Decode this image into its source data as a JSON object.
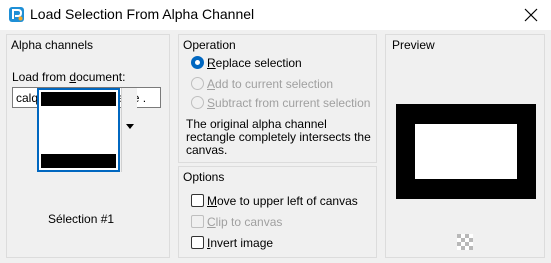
{
  "window": {
    "title": "Load Selection From Alpha Channel",
    "close_glyph": "×"
  },
  "alpha_channels": {
    "title": "Alpha channels",
    "load_label_prefix": "Load from ",
    "load_label_underlined": "d",
    "load_label_suffix": "ocument:",
    "document_value": "calque_alpha_adelaide .",
    "selection_name": "Sélection #1"
  },
  "operation": {
    "title": "Operation",
    "options": [
      {
        "prefix": "",
        "underlined": "R",
        "suffix": "eplace selection",
        "checked": true,
        "enabled": true
      },
      {
        "prefix": "",
        "underlined": "A",
        "suffix": "dd to current selection",
        "checked": false,
        "enabled": false
      },
      {
        "prefix": "",
        "underlined": "S",
        "suffix": "ubtract from current selection",
        "checked": false,
        "enabled": false
      }
    ],
    "description": "The original alpha channel rectangle completely intersects the canvas."
  },
  "options": {
    "title": "Options",
    "items": [
      {
        "prefix": "",
        "underlined": "M",
        "suffix": "ove to upper left of canvas",
        "checked": false,
        "enabled": true
      },
      {
        "prefix": "",
        "underlined": "C",
        "suffix": "lip to canvas",
        "checked": false,
        "enabled": false
      },
      {
        "prefix": "",
        "underlined": "I",
        "suffix": "nvert image",
        "checked": false,
        "enabled": true
      }
    ]
  },
  "preview": {
    "title": "Preview"
  },
  "colors": {
    "accent": "#0067c0",
    "dialog_bg": "#f0f0f0",
    "disabled_text": "#a0a0a0"
  },
  "icons": {
    "app": "paintshop-app-icon",
    "close": "close-icon",
    "dropdown": "chevron-down-icon",
    "checker": "transparency-checker-icon"
  }
}
